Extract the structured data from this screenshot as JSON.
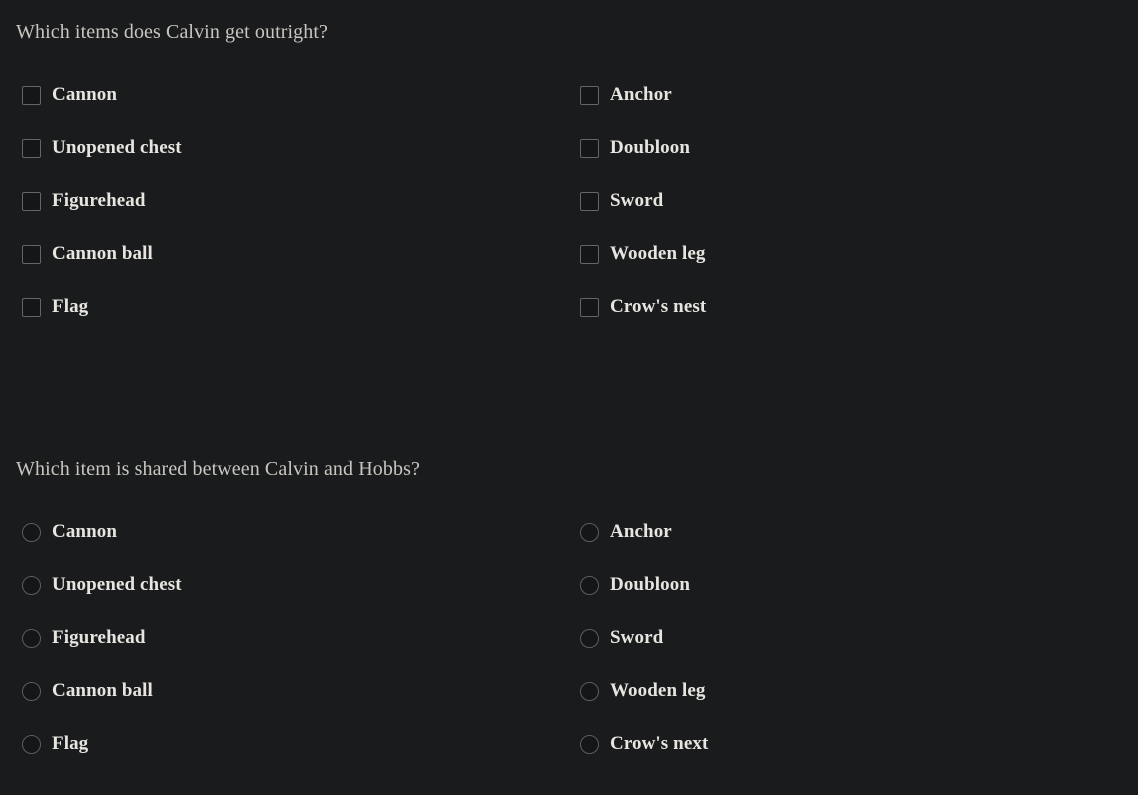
{
  "background_color": "#191b1d",
  "text_color": "#e7e5e0",
  "question_color": "#c9c6c0",
  "control_border_color": "#5f666d",
  "questions": [
    {
      "id": "calvin-outright",
      "title": "Which items does Calvin get outright?",
      "input_type": "checkbox",
      "columns": [
        {
          "options": [
            {
              "label": "Cannon",
              "checked": false
            },
            {
              "label": "Unopened chest",
              "checked": false
            },
            {
              "label": "Figurehead",
              "checked": false
            },
            {
              "label": "Cannon ball",
              "checked": false
            },
            {
              "label": "Flag",
              "checked": false
            }
          ]
        },
        {
          "options": [
            {
              "label": "Anchor",
              "checked": false
            },
            {
              "label": "Doubloon",
              "checked": false
            },
            {
              "label": "Sword",
              "checked": false
            },
            {
              "label": "Wooden leg",
              "checked": false
            },
            {
              "label": "Crow's nest",
              "checked": false
            }
          ]
        }
      ]
    },
    {
      "id": "calvin-hobbs-shared",
      "title": "Which item is shared between Calvin and Hobbs?",
      "input_type": "radio",
      "columns": [
        {
          "options": [
            {
              "label": "Cannon",
              "checked": false
            },
            {
              "label": "Unopened chest",
              "checked": false
            },
            {
              "label": "Figurehead",
              "checked": false
            },
            {
              "label": "Cannon ball",
              "checked": false
            },
            {
              "label": "Flag",
              "checked": false
            }
          ]
        },
        {
          "options": [
            {
              "label": "Anchor",
              "checked": false
            },
            {
              "label": "Doubloon",
              "checked": false
            },
            {
              "label": "Sword",
              "checked": false
            },
            {
              "label": "Wooden leg",
              "checked": false
            },
            {
              "label": "Crow's next",
              "checked": false
            }
          ]
        }
      ]
    }
  ],
  "layout": {
    "question_tops": [
      20,
      457
    ],
    "row_spacing": 53,
    "column_lefts": [
      22,
      580
    ]
  }
}
